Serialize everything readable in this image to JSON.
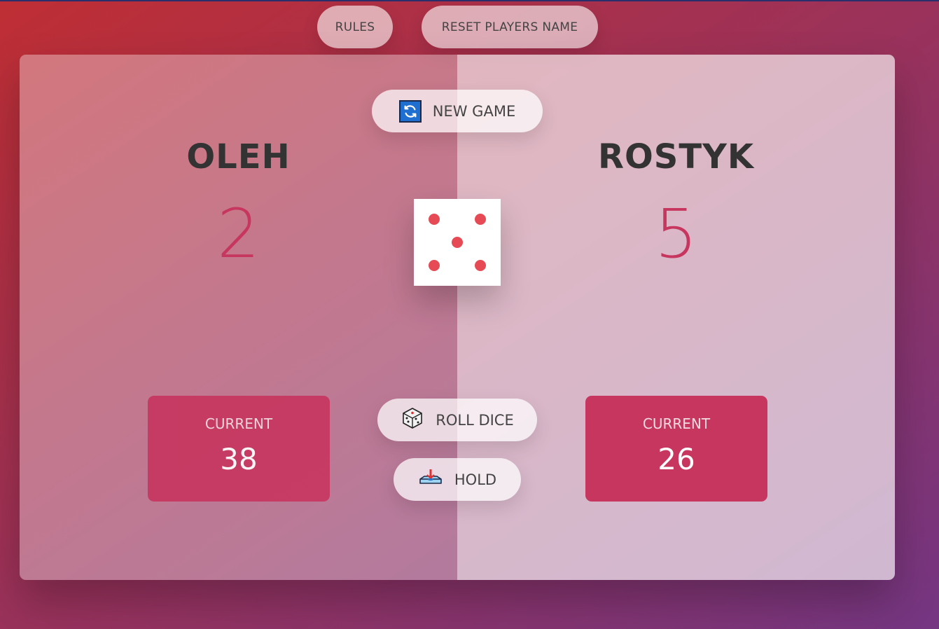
{
  "header": {
    "rules_label": "RULES",
    "reset_label": "RESET PLAYERS NAME"
  },
  "controls": {
    "new_game_label": "NEW GAME",
    "roll_label": "ROLL DICE",
    "hold_label": "HOLD"
  },
  "players": [
    {
      "name": "OLEH",
      "score": "2",
      "current_label": "CURRENT",
      "current_score": "38",
      "active": false
    },
    {
      "name": "ROSTYK",
      "score": "5",
      "current_label": "CURRENT",
      "current_score": "26",
      "active": true
    }
  ],
  "dice": {
    "value": 5
  },
  "icons": {
    "new_game": "refresh-icon",
    "roll": "dice-icon",
    "hold": "hold-icon"
  },
  "colors": {
    "accent": "#c7365f",
    "dice_dot": "#e64b55"
  }
}
